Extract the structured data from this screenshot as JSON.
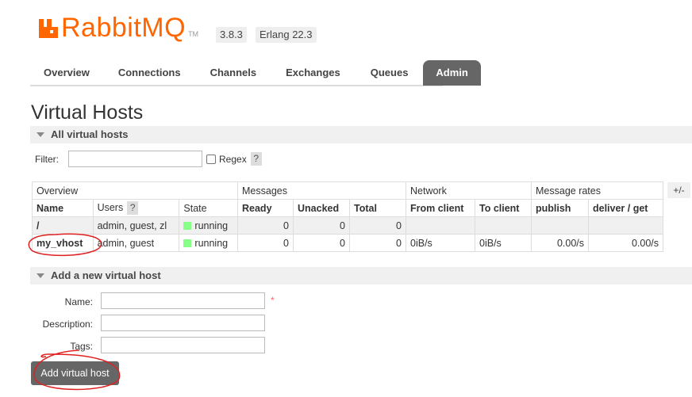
{
  "header": {
    "logo_text": "RabbitMQ",
    "logo_tm": "TM",
    "version": "3.8.3",
    "erlang": "Erlang 22.3"
  },
  "tabs": [
    {
      "label": "Overview"
    },
    {
      "label": "Connections"
    },
    {
      "label": "Channels"
    },
    {
      "label": "Exchanges"
    },
    {
      "label": "Queues"
    },
    {
      "label": "Admin",
      "active": true
    }
  ],
  "page_title": "Virtual Hosts",
  "all_vhosts": {
    "section_title": "All virtual hosts",
    "filter_label": "Filter:",
    "filter_value": "",
    "regex_label": "Regex",
    "help": "?",
    "group_headers": [
      "Overview",
      "Messages",
      "Network",
      "Message rates"
    ],
    "columns": [
      "Name",
      "Users",
      "State",
      "Ready",
      "Unacked",
      "Total",
      "From client",
      "To client",
      "publish",
      "deliver / get"
    ],
    "plusminus": "+/-",
    "rows": [
      {
        "name": "/",
        "users": "admin, guest, zl",
        "state": "running",
        "ready": "0",
        "unacked": "0",
        "total": "0",
        "from_client": "",
        "to_client": "",
        "publish": "",
        "deliver": ""
      },
      {
        "name": "my_vhost",
        "users": "admin, guest",
        "state": "running",
        "ready": "0",
        "unacked": "0",
        "total": "0",
        "from_client": "0iB/s",
        "to_client": "0iB/s",
        "publish": "0.00/s",
        "deliver": "0.00/s"
      }
    ]
  },
  "add_vhost": {
    "section_title": "Add a new virtual host",
    "name_label": "Name:",
    "description_label": "Description:",
    "tags_label": "Tags:",
    "required_mark": "*",
    "button_label": "Add virtual host"
  },
  "colors": {
    "brand": "#ff6600",
    "tab_active": "#666666",
    "annotation": "#e02020",
    "running": "#88ff88"
  }
}
